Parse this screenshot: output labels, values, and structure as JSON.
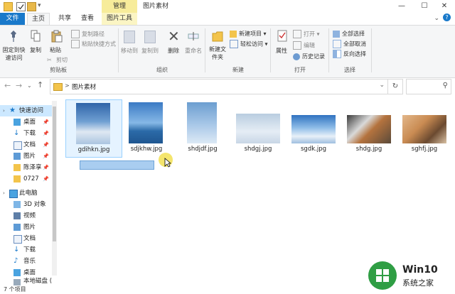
{
  "window": {
    "title": "图片素材",
    "context_tab_group": "管理",
    "minimize": "—",
    "maximize": "☐",
    "close": "✕"
  },
  "tabs": [
    {
      "label": "文件"
    },
    {
      "label": "主页"
    },
    {
      "label": "共享"
    },
    {
      "label": "查看"
    },
    {
      "label": "图片工具"
    }
  ],
  "ribbon": {
    "clipboard": {
      "pin_quick": "固定到快速访问",
      "copy": "复制",
      "paste": "粘贴",
      "copy_path": "复制路径",
      "paste_shortcut": "粘贴快捷方式",
      "cut": "剪切",
      "group": "剪贴板"
    },
    "organize": {
      "move_to": "移动到",
      "copy_to": "复制到",
      "delete": "删除",
      "rename": "重命名",
      "group": "组织"
    },
    "new": {
      "new_folder": "新建文件夹",
      "new_item": "新建项目",
      "easy_access": "轻松访问",
      "group": "新建"
    },
    "open": {
      "properties": "属性",
      "open": "打开",
      "edit": "编辑",
      "history": "历史记录",
      "group": "打开"
    },
    "select": {
      "select_all": "全部选择",
      "select_none": "全部取消",
      "invert": "反向选择",
      "group": "选择"
    }
  },
  "address": {
    "path": "图片素材",
    "separator": ">"
  },
  "nav": {
    "quick_access": "快速访问",
    "quick_items": [
      {
        "label": "桌面"
      },
      {
        "label": "下载"
      },
      {
        "label": "文档"
      },
      {
        "label": "图片"
      },
      {
        "label": "陈泽享"
      },
      {
        "label": "0727"
      }
    ],
    "this_pc": "此电脑",
    "pc_items": [
      {
        "label": "3D 对象"
      },
      {
        "label": "视频"
      },
      {
        "label": "图片"
      },
      {
        "label": "文档"
      },
      {
        "label": "下载"
      },
      {
        "label": "音乐"
      },
      {
        "label": "桌面"
      },
      {
        "label": "本地磁盘 ("
      }
    ]
  },
  "files": [
    {
      "name": "gdihkn.jpg"
    },
    {
      "name": "sdjkhw.jpg"
    },
    {
      "name": "shdjdf.jpg"
    },
    {
      "name": "shdgj.jpg"
    },
    {
      "name": "sgdk.jpg"
    },
    {
      "name": "shdg.jpg"
    },
    {
      "name": "sghfj.jpg"
    }
  ],
  "status": {
    "count": "7 个项目"
  },
  "watermark": {
    "brand": "Win10",
    "sub": "系统之家"
  },
  "colors": {
    "accent": "#1979ca",
    "context_tab": "#f7ec9a",
    "selection": "#cce8ff",
    "rename_box": "#a9cdf0"
  }
}
